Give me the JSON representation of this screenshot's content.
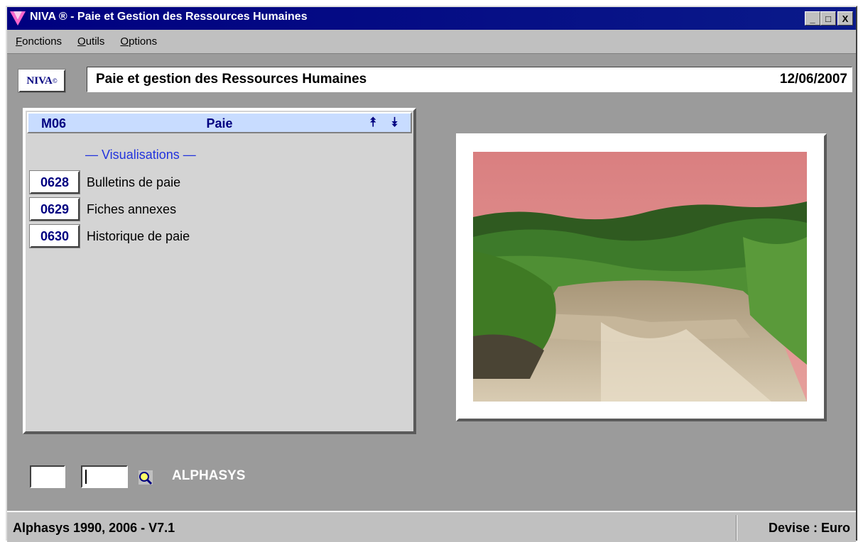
{
  "window": {
    "title": "NIVA ® - Paie et Gestion des Ressources Humaines",
    "buttons": {
      "minimize": "_",
      "maximize": "□",
      "close": "X"
    }
  },
  "menubar": {
    "items": [
      {
        "label": "Fonctions",
        "accel": "F",
        "rest": "onctions"
      },
      {
        "label": "Outils",
        "accel": "O",
        "rest": "utils"
      },
      {
        "label": "Options",
        "accel": "O",
        "rest": "ptions"
      }
    ]
  },
  "header": {
    "niva_button": "NIVA",
    "niva_mark": "©",
    "title": "Paie et gestion des Ressources Humaines",
    "date": "12/06/2007"
  },
  "panel": {
    "code": "M06",
    "title": "Paie",
    "section": "— Visualisations —",
    "items": [
      {
        "code": "0628",
        "label": "Bulletins de paie"
      },
      {
        "code": "0629",
        "label": "Fiches annexes"
      },
      {
        "code": "0630",
        "label": "Historique de paie"
      }
    ]
  },
  "bottom": {
    "company": "ALPHASYS"
  },
  "status": {
    "left": "Alphasys 1990, 2006 - V7.1",
    "right": "Devise : Euro"
  },
  "colors": {
    "titlebar": "#000080",
    "desktop": "#9b9b9b",
    "panel_header": "#c8dcff",
    "accent_text": "#000080",
    "section_text": "#2233dd"
  },
  "icons": [
    "niva-logo-icon",
    "minimize-icon",
    "maximize-icon",
    "close-icon",
    "scroll-up-icon",
    "scroll-down-icon",
    "search-icon"
  ]
}
